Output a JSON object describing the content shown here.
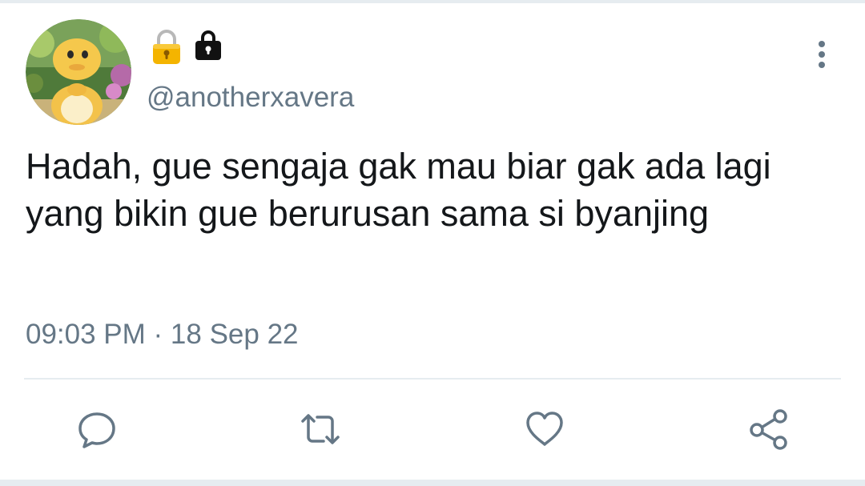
{
  "tweet": {
    "handle": "@anotherxavera",
    "text": "Hadah, gue sengaja gak mau biar gak ada lagi yang bikin gue berurusan sama si byanjing",
    "time": "09:03 PM",
    "separator": " · ",
    "date": "18 Sep 22",
    "badges": [
      "lock-yellow-icon",
      "lock-black-icon"
    ]
  },
  "actions": [
    {
      "name": "reply",
      "icon": "comment-bubble-icon"
    },
    {
      "name": "retweet",
      "icon": "retweet-icon"
    },
    {
      "name": "like",
      "icon": "heart-icon"
    },
    {
      "name": "share",
      "icon": "share-icon"
    }
  ],
  "colors": {
    "text": "#14171a",
    "secondary": "#657786",
    "icon": "#657786",
    "divider": "#e6ecf0"
  }
}
